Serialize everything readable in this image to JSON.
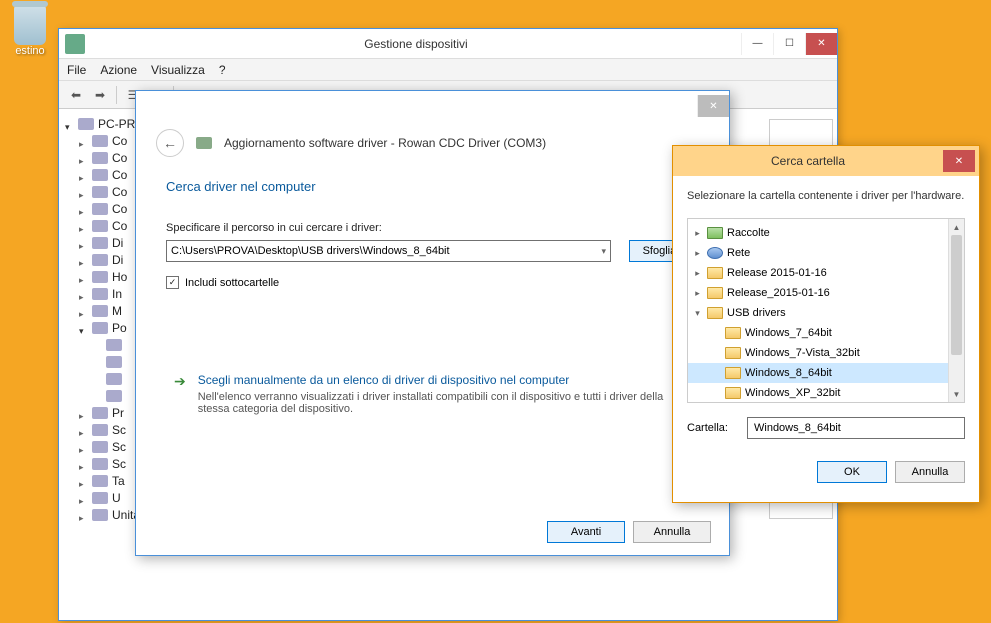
{
  "desktop": {
    "recycle_label": "estino"
  },
  "devmgr": {
    "title": "Gestione dispositivi",
    "menu": {
      "file": "File",
      "action": "Azione",
      "view": "Visualizza",
      "help": "?"
    },
    "root": "PC-PR",
    "items": [
      "Co",
      "Co",
      "Co",
      "Co",
      "Co",
      "Co",
      "Di",
      "Di",
      "Ho",
      "In",
      "M",
      "Po",
      "",
      "",
      "",
      "",
      "Pr",
      "Sc",
      "Sc",
      "Sc",
      "Ta",
      "U",
      "Unità floppy"
    ],
    "last_full": "Unità DVD/CD-ROM"
  },
  "driver": {
    "header_title": "Aggiornamento software driver - Rowan CDC Driver (COM3)",
    "h1": "Cerca driver nel computer",
    "path_label": "Specificare il percorso in cui cercare i driver:",
    "path_value": "C:\\Users\\PROVA\\Desktop\\USB drivers\\Windows_8_64bit",
    "browse": "Sfoglia...",
    "include_sub": "Includi sottocartelle",
    "opt_title": "Scegli manualmente da un elenco di driver di dispositivo nel computer",
    "opt_desc": "Nell'elenco verranno visualizzati i driver installati compatibili con il dispositivo e tutti i driver della stessa categoria del dispositivo.",
    "next": "Avanti",
    "cancel": "Annulla"
  },
  "browse": {
    "title": "Cerca cartella",
    "msg": "Selezionare la cartella contenente i driver per l'hardware.",
    "tree": {
      "raccolte": "Raccolte",
      "rete": "Rete",
      "rel1": "Release 2015-01-16",
      "rel2": "Release_2015-01-16",
      "usb": "USB drivers",
      "w7_64": "Windows_7_64bit",
      "w7_v32": "Windows_7-Vista_32bit",
      "w8_64": "Windows_8_64bit",
      "wxp_32": "Windows_XP_32bit"
    },
    "folder_label": "Cartella:",
    "folder_value": "Windows_8_64bit",
    "ok": "OK",
    "cancel": "Annulla"
  }
}
